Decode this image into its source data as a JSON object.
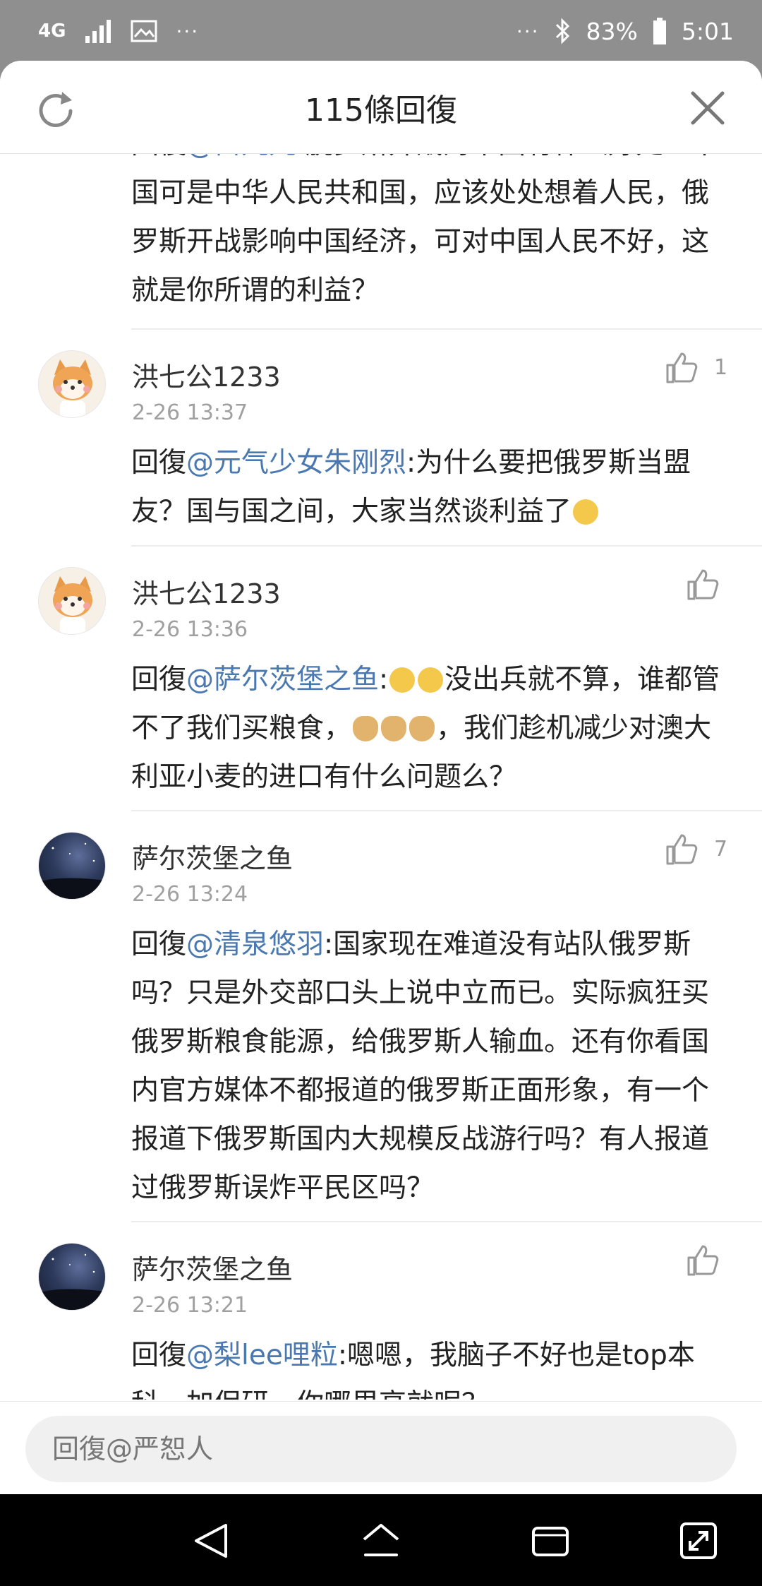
{
  "status_bar": {
    "network": "4G",
    "dots_left": "···",
    "dots_right": "···",
    "battery": "83%",
    "time": "5:01"
  },
  "header": {
    "title": "115條回復"
  },
  "comments": [
    {
      "reply_prefix": "回復",
      "mention": "@白九九",
      "text": ":脱罗斯开战对中国有什么好处？中国可是中华人民共和国，应该处处想着人民，俄罗斯开战影响中国经济，可对中国人民不好，这就是你所谓的利益？"
    },
    {
      "username": "洪七公1233",
      "timestamp": "2-26 13:37",
      "likes": "1",
      "reply_prefix": "回復",
      "mention": "@元气少女朱刚烈",
      "text": ":为什么要把俄罗斯当盟友？国与国之间，大家当然谈利益了"
    },
    {
      "username": "洪七公1233",
      "timestamp": "2-26 13:36",
      "likes": "",
      "reply_prefix": "回復",
      "mention": "@萨尔茨堡之鱼",
      "text_a": ":",
      "text_b": "没出兵就不算，谁都管不了我们买粮食，",
      "text_c": "，我们趁机减少对澳大利亚小麦的进口有什么问题么？"
    },
    {
      "username": "萨尔茨堡之鱼",
      "timestamp": "2-26 13:24",
      "likes": "7",
      "reply_prefix": "回復",
      "mention": "@清泉悠羽",
      "text": ":国家现在难道没有站队俄罗斯吗？只是外交部口头上说中立而已。实际疯狂买俄罗斯粮食能源，给俄罗斯人输血。还有你看国内官方媒体不都报道的俄罗斯正面形象，有一个报道下俄罗斯国内大规模反战游行吗？有人报道过俄罗斯误炸平民区吗？"
    },
    {
      "username": "萨尔茨堡之鱼",
      "timestamp": "2-26 13:21",
      "likes": "",
      "reply_prefix": "回復",
      "mention": "@梨lee哩粒",
      "text": ":嗯嗯，我脑子不好也是top本科，加保研。你哪里高就呢？"
    }
  ],
  "input": {
    "placeholder": "回復@严恕人"
  },
  "colors": {
    "mention": "#4a78b0",
    "status_bar_bg": "#8f8f8f",
    "nav_bg": "#000000"
  },
  "icons": [
    "refresh-icon",
    "close-icon",
    "thumbs-up-icon",
    "back-icon",
    "home-icon",
    "recents-icon",
    "rotate-icon",
    "signal-icon",
    "gallery-icon",
    "bluetooth-icon",
    "battery-icon"
  ]
}
